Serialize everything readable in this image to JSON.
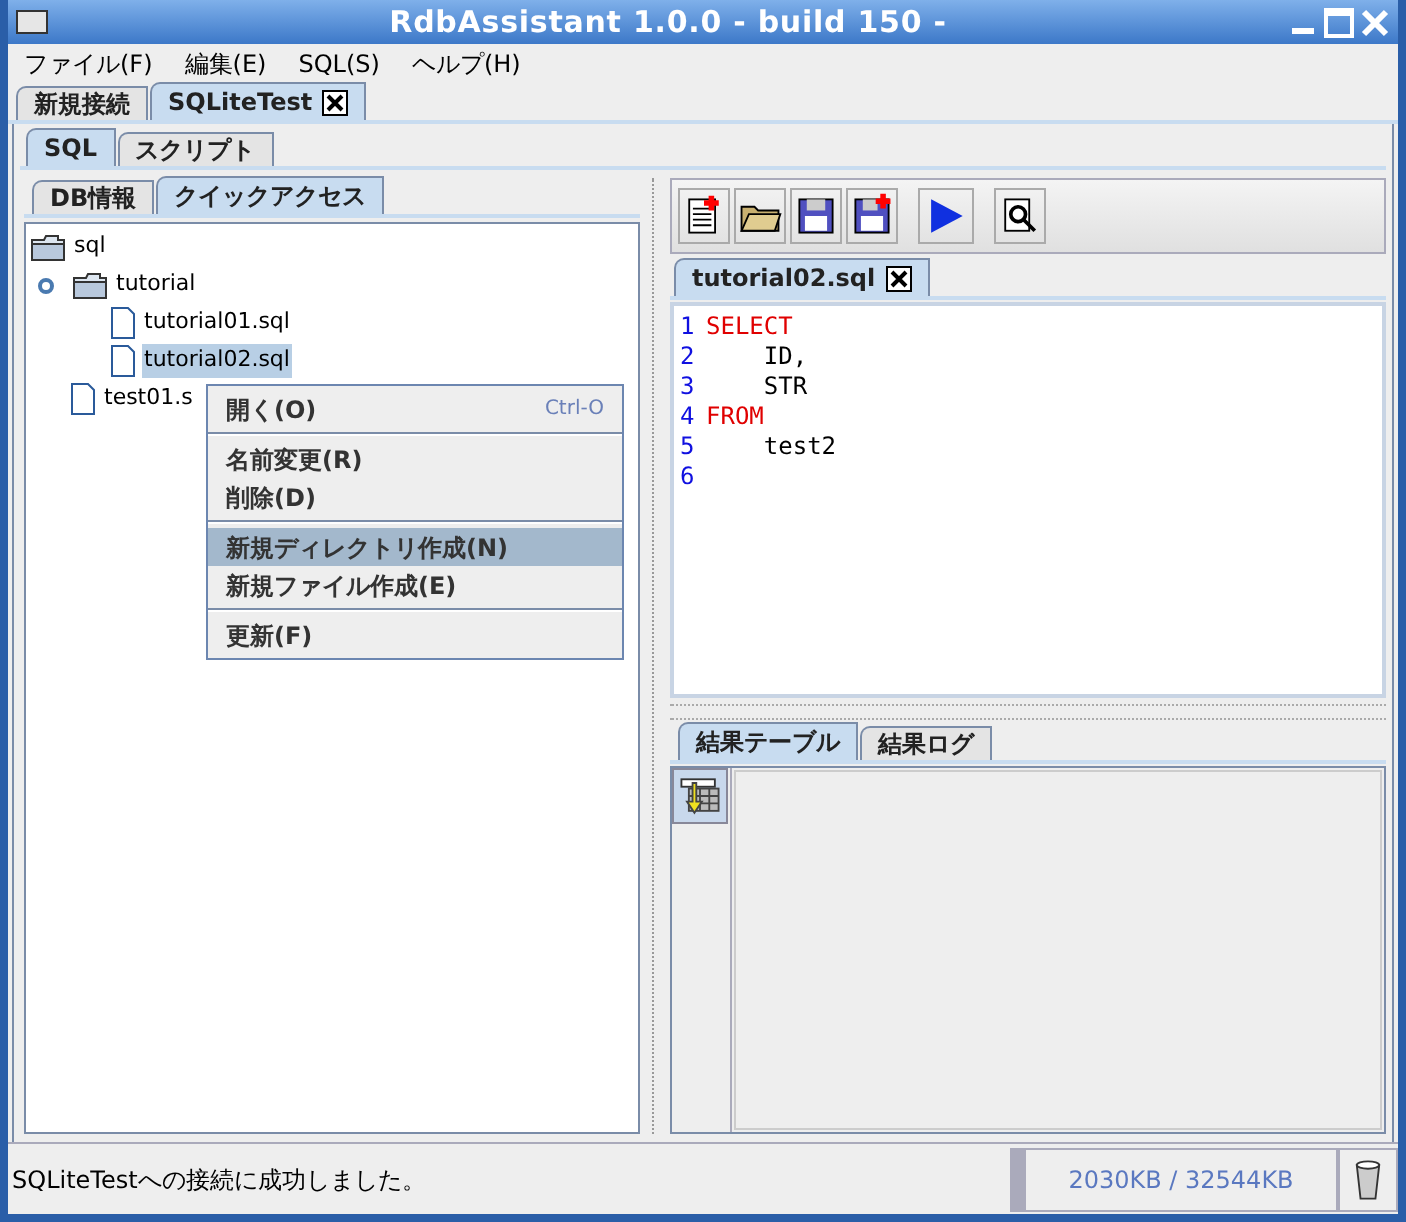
{
  "window": {
    "title": "RdbAssistant 1.0.0 - build 150 -"
  },
  "menu": [
    "ファイル(F)",
    "編集(E)",
    "SQL(S)",
    "ヘルプ(H)"
  ],
  "connection_tabs": [
    {
      "label": "新規接続",
      "selected": false
    },
    {
      "label": "SQLiteTest",
      "selected": true,
      "closable": true
    }
  ],
  "mode_tabs": [
    {
      "label": "SQL",
      "selected": true
    },
    {
      "label": "スクリプト",
      "selected": false
    }
  ],
  "left_tabs": [
    {
      "label": "DB情報",
      "selected": false
    },
    {
      "label": "クイックアクセス",
      "selected": true
    }
  ],
  "tree": [
    {
      "label": "sql",
      "kind": "folder",
      "selected": false,
      "children": [
        {
          "label": "tutorial",
          "kind": "folder",
          "selected": false,
          "expanded": true,
          "children": [
            {
              "label": "tutorial01.sql",
              "kind": "file",
              "selected": false
            },
            {
              "label": "tutorial02.sql",
              "kind": "file",
              "selected": true
            }
          ]
        },
        {
          "label": "test01.s",
          "kind": "file",
          "selected": false
        }
      ]
    }
  ],
  "context_menu": [
    [
      {
        "label": "開く(O)",
        "shortcut": "Ctrl-O",
        "selected": false
      }
    ],
    [
      {
        "label": "名前変更(R)",
        "selected": false
      },
      {
        "label": "削除(D)",
        "selected": false
      }
    ],
    [
      {
        "label": "新規ディレクトリ作成(N)",
        "selected": true
      },
      {
        "label": "新規ファイル作成(E)",
        "selected": false
      }
    ],
    [
      {
        "label": "更新(F)",
        "selected": false
      }
    ]
  ],
  "editor_tabs": [
    {
      "label": "tutorial02.sql",
      "selected": true,
      "closable": true
    }
  ],
  "editor_lines": [
    {
      "number": "1",
      "text": "SELECT",
      "kind": "keyword"
    },
    {
      "number": "2",
      "text": "    ID,",
      "kind": "plain"
    },
    {
      "number": "3",
      "text": "    STR",
      "kind": "plain"
    },
    {
      "number": "4",
      "text": "FROM",
      "kind": "keyword"
    },
    {
      "number": "5",
      "text": "    test2",
      "kind": "plain"
    },
    {
      "number": "6",
      "kind": "plain"
    }
  ],
  "result_tabs": [
    {
      "label": "結果テーブル",
      "selected": true
    },
    {
      "label": "結果ログ",
      "selected": false
    }
  ],
  "status_bar": {
    "message": "SQLiteTestへの接続に成功しました。",
    "memory": "2030KB / 32544KB"
  }
}
